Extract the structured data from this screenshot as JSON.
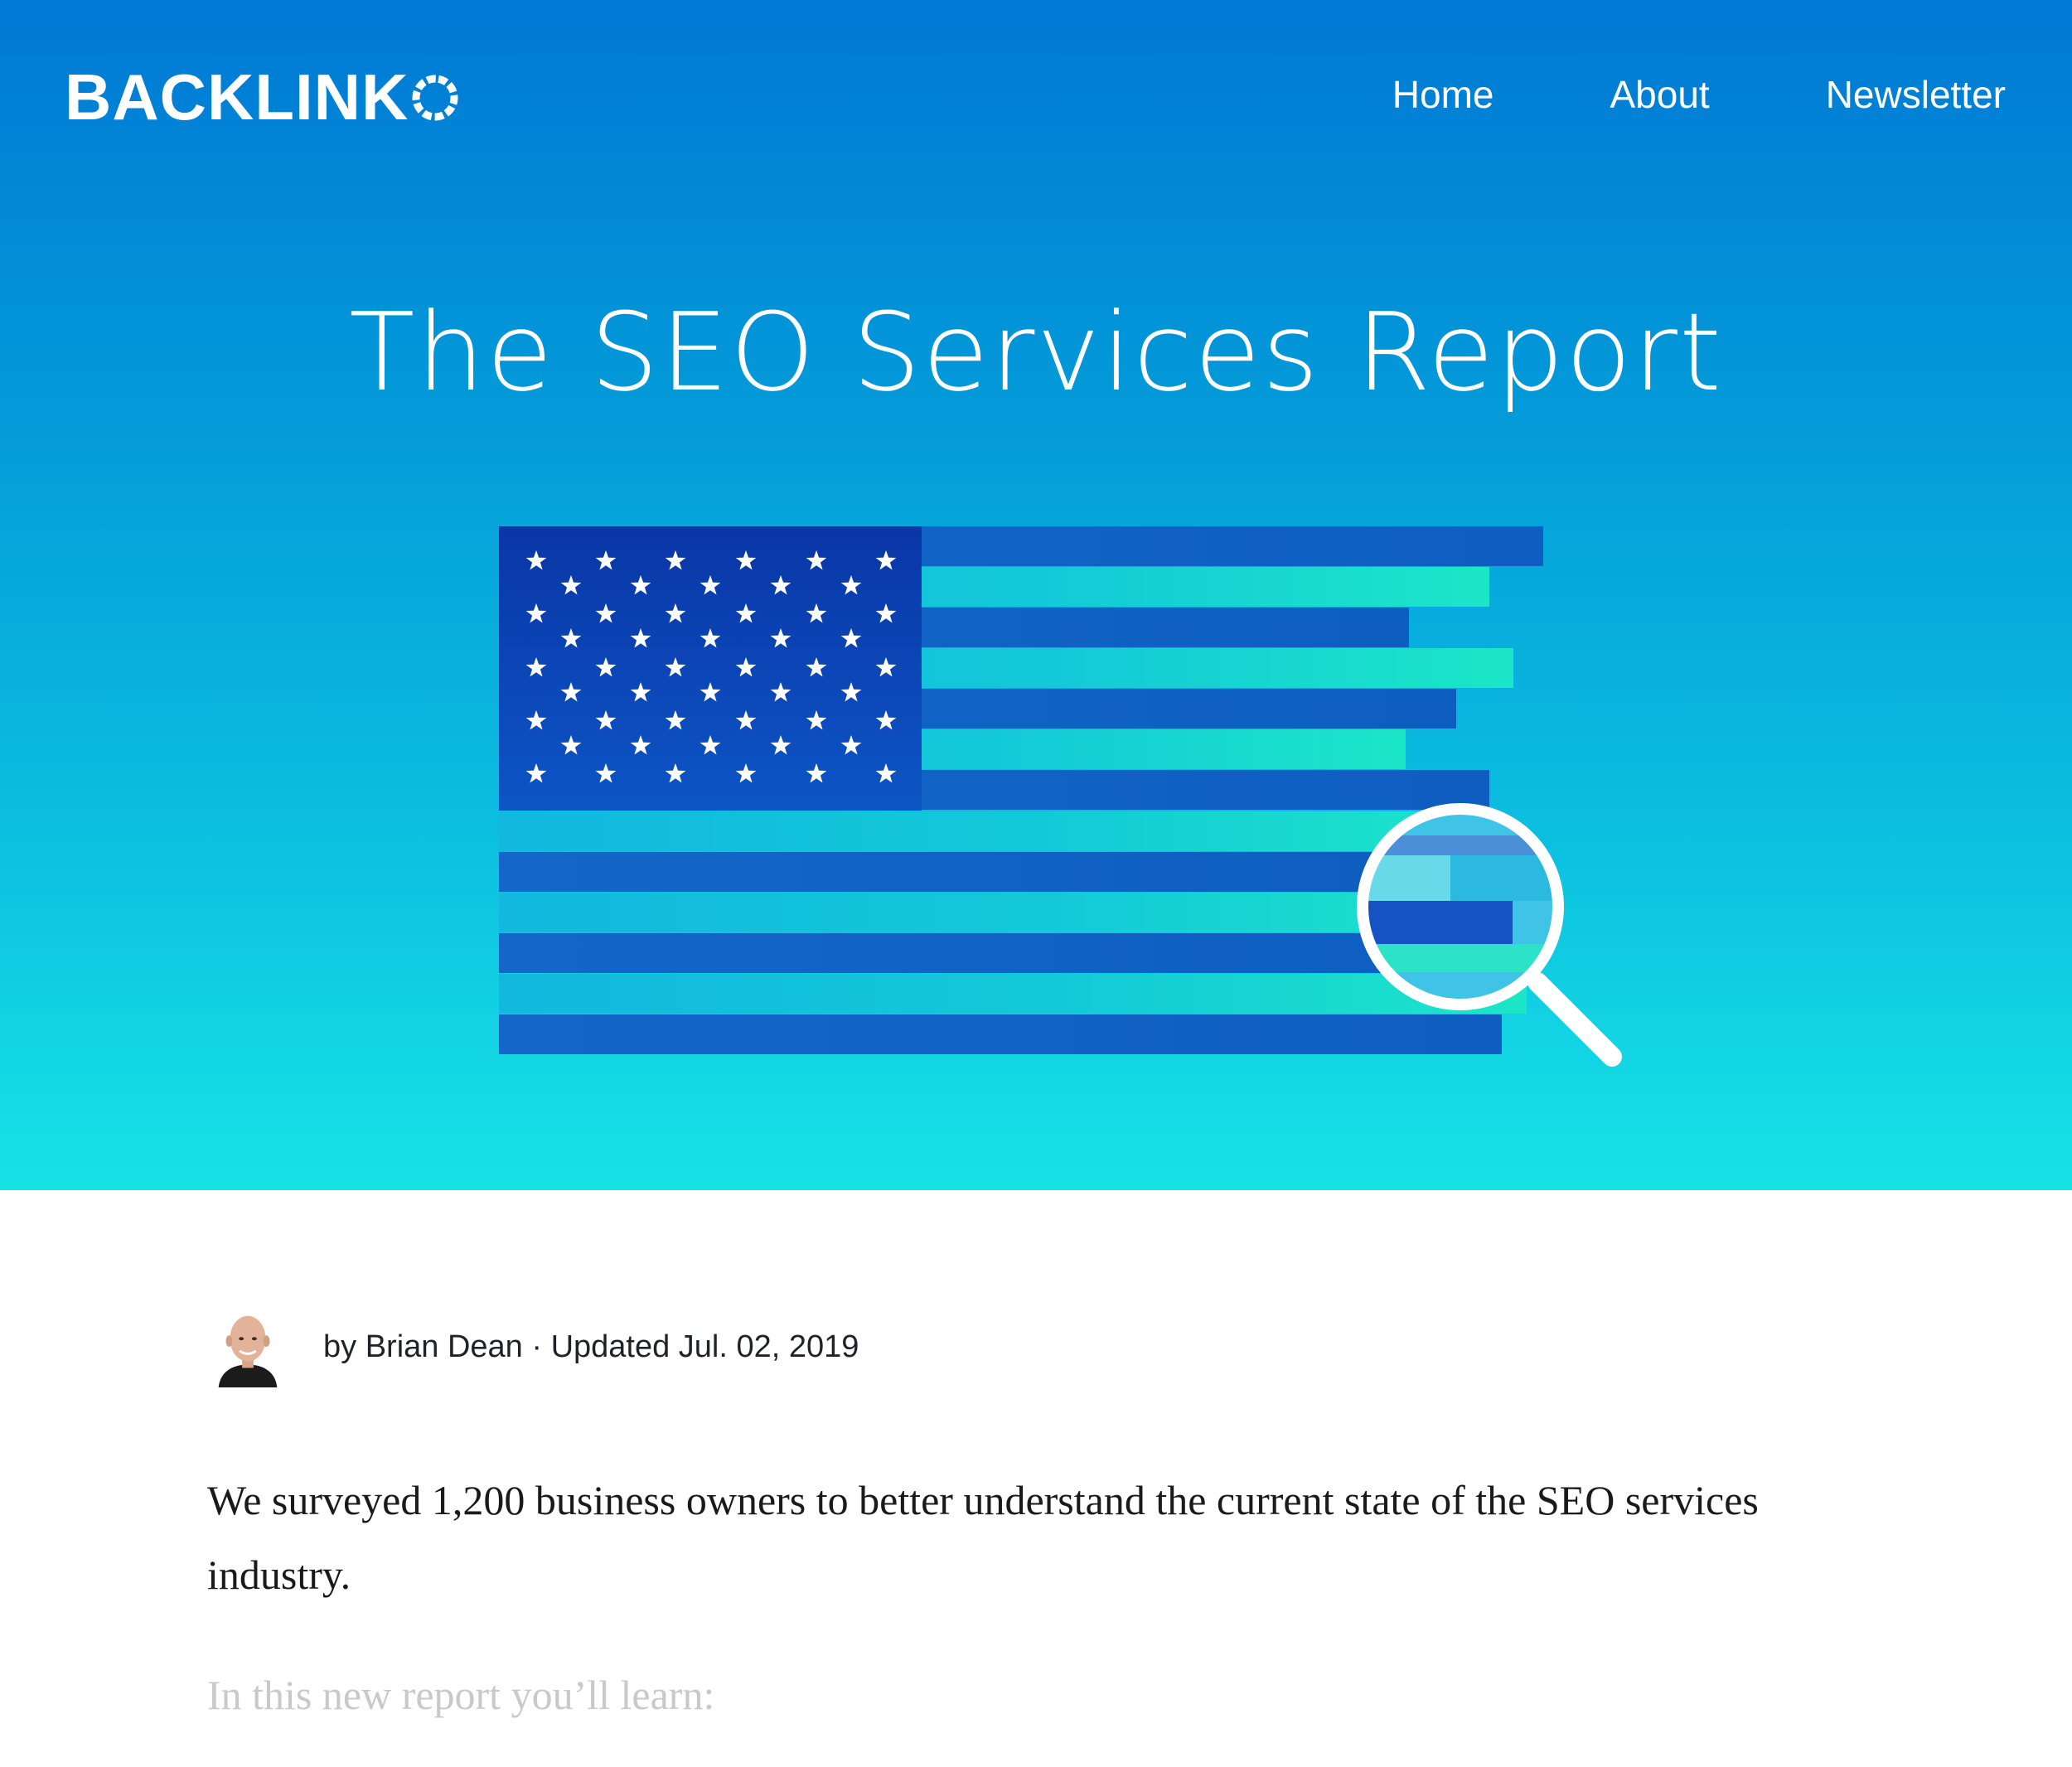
{
  "header": {
    "logo_text": "BACKLINK",
    "logo_icon": "ring-o-icon",
    "nav": [
      {
        "label": "Home"
      },
      {
        "label": "About"
      },
      {
        "label": "Newsletter"
      }
    ]
  },
  "hero": {
    "title": "The SEO Services Report",
    "illustration": "us-flag-with-magnifying-glass",
    "gradient_top": "#0078d4",
    "gradient_bottom": "#17e3e6"
  },
  "article": {
    "byline": "by Brian Dean · Updated Jul. 02, 2019",
    "intro": "We surveyed 1,200 business owners to better understand the current state of the SEO services industry.",
    "learn_heading": "In this new report you’ll learn:"
  },
  "colors": {
    "dark_stripe": "#0f5fc4",
    "light_stripe_start": "#12b8de",
    "light_stripe_end": "#1ce6c8",
    "canton": "#0a3aa8"
  }
}
